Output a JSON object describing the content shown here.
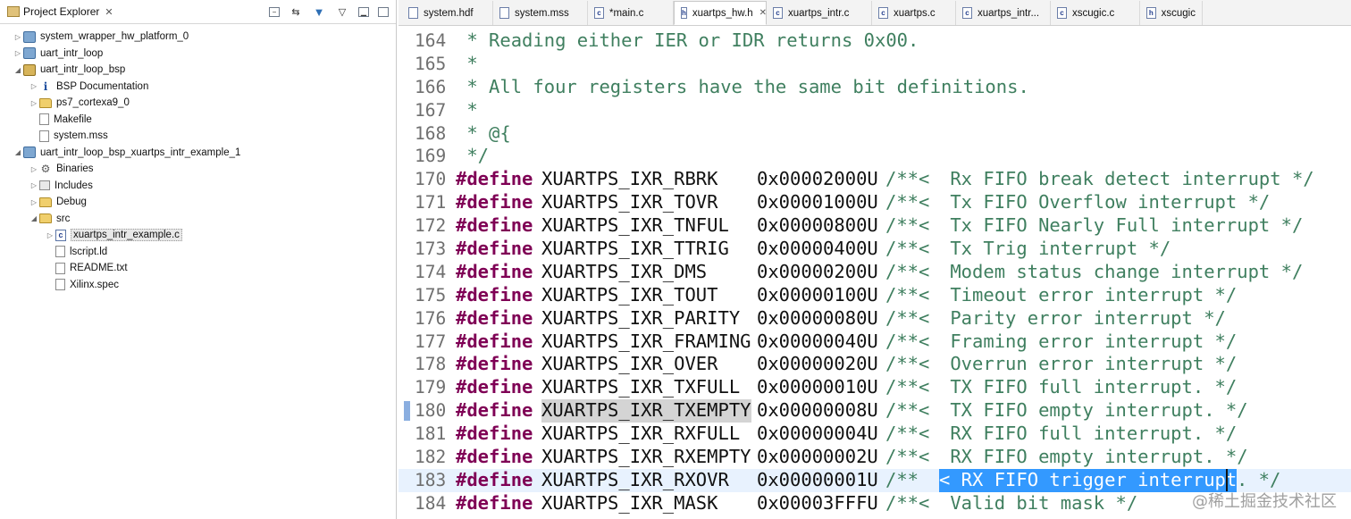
{
  "left_panel": {
    "title": "Project Explorer",
    "tree": [
      {
        "label": "system_wrapper_hw_platform_0",
        "arrow": "▷",
        "indent": 0,
        "icon": "proj"
      },
      {
        "label": "uart_intr_loop",
        "arrow": "▷",
        "indent": 0,
        "icon": "proj"
      },
      {
        "label": "uart_intr_loop_bsp",
        "arrow": "◢",
        "indent": 0,
        "icon": "bsp"
      },
      {
        "label": "BSP Documentation",
        "arrow": "▷",
        "indent": 1,
        "icon": "info"
      },
      {
        "label": "ps7_cortexa9_0",
        "arrow": "▷",
        "indent": 1,
        "icon": "folder"
      },
      {
        "label": "Makefile",
        "arrow": "",
        "indent": 1,
        "icon": "file"
      },
      {
        "label": "system.mss",
        "arrow": "",
        "indent": 1,
        "icon": "file"
      },
      {
        "label": "uart_intr_loop_bsp_xuartps_intr_example_1",
        "arrow": "◢",
        "indent": 0,
        "icon": "proj"
      },
      {
        "label": "Binaries",
        "arrow": "▷",
        "indent": 1,
        "icon": "bin"
      },
      {
        "label": "Includes",
        "arrow": "▷",
        "indent": 1,
        "icon": "inc"
      },
      {
        "label": "Debug",
        "arrow": "▷",
        "indent": 1,
        "icon": "folder"
      },
      {
        "label": "src",
        "arrow": "◢",
        "indent": 1,
        "icon": "folder"
      },
      {
        "label": "xuartps_intr_example.c",
        "arrow": "▷",
        "indent": 2,
        "icon": "cfile",
        "selected": true
      },
      {
        "label": "lscript.ld",
        "arrow": "",
        "indent": 2,
        "icon": "file"
      },
      {
        "label": "README.txt",
        "arrow": "",
        "indent": 2,
        "icon": "file"
      },
      {
        "label": "Xilinx.spec",
        "arrow": "",
        "indent": 2,
        "icon": "file"
      }
    ]
  },
  "editor": {
    "tabs": [
      {
        "label": "system.hdf",
        "icon": "",
        "active": false
      },
      {
        "label": "system.mss",
        "icon": "",
        "active": false
      },
      {
        "label": "*main.c",
        "icon": "c",
        "active": false
      },
      {
        "label": "xuartps_hw.h",
        "icon": "h",
        "active": true
      },
      {
        "label": "xuartps_intr.c",
        "icon": "c",
        "active": false
      },
      {
        "label": "xuartps.c",
        "icon": "c",
        "active": false
      },
      {
        "label": "xuartps_intr...",
        "icon": "c",
        "active": false
      },
      {
        "label": "xscugic.c",
        "icon": "c",
        "active": false
      },
      {
        "label": "xscugic",
        "icon": "h",
        "active": false
      }
    ],
    "comment_lines": [
      {
        "num": "164",
        "text": " * Reading either IER or IDR returns 0x00."
      },
      {
        "num": "165",
        "text": " *"
      },
      {
        "num": "166",
        "text": " * All four registers have the same bit definitions."
      },
      {
        "num": "167",
        "text": " *"
      },
      {
        "num": "168",
        "text": " * @{"
      },
      {
        "num": "169",
        "text": " */"
      }
    ],
    "define_lines": [
      {
        "num": "170",
        "kw": "#define",
        "name": "XUARTPS_IXR_RBRK",
        "value": "0x00002000U",
        "c1": "/**<",
        "comment": " Rx FIFO break detect interrupt */"
      },
      {
        "num": "171",
        "kw": "#define",
        "name": "XUARTPS_IXR_TOVR",
        "value": "0x00001000U",
        "c1": "/**<",
        "comment": " Tx FIFO Overflow interrupt */"
      },
      {
        "num": "172",
        "kw": "#define",
        "name": "XUARTPS_IXR_TNFUL",
        "value": "0x00000800U",
        "c1": "/**<",
        "comment": " Tx FIFO Nearly Full interrupt */"
      },
      {
        "num": "173",
        "kw": "#define",
        "name": "XUARTPS_IXR_TTRIG",
        "value": "0x00000400U",
        "c1": "/**<",
        "comment": " Tx Trig interrupt */"
      },
      {
        "num": "174",
        "kw": "#define",
        "name": "XUARTPS_IXR_DMS",
        "value": "0x00000200U",
        "c1": "/**<",
        "comment": " Modem status change interrupt */"
      },
      {
        "num": "175",
        "kw": "#define",
        "name": "XUARTPS_IXR_TOUT",
        "value": "0x00000100U",
        "c1": "/**<",
        "comment": " Timeout error interrupt */"
      },
      {
        "num": "176",
        "kw": "#define",
        "name": "XUARTPS_IXR_PARITY",
        "value": "0x00000080U",
        "c1": "/**<",
        "comment": " Parity error interrupt */"
      },
      {
        "num": "177",
        "kw": "#define",
        "name": "XUARTPS_IXR_FRAMING",
        "value": "0x00000040U",
        "c1": "/**<",
        "comment": " Framing error interrupt */"
      },
      {
        "num": "178",
        "kw": "#define",
        "name": "XUARTPS_IXR_OVER",
        "value": "0x00000020U",
        "c1": "/**<",
        "comment": " Overrun error interrupt */"
      },
      {
        "num": "179",
        "kw": "#define",
        "name": "XUARTPS_IXR_TXFULL",
        "value": "0x00000010U",
        "c1": "/**<",
        "comment": " TX FIFO full interrupt. */"
      },
      {
        "num": "180",
        "kw": "#define",
        "name": "XUARTPS_IXR_TXEMPTY",
        "value": "0x00000008U",
        "c1": "/**<",
        "comment": " TX FIFO empty interrupt. */"
      },
      {
        "num": "181",
        "kw": "#define",
        "name": "XUARTPS_IXR_RXFULL",
        "value": "0x00000004U",
        "c1": "/**<",
        "comment": " RX FIFO full interrupt. */"
      },
      {
        "num": "182",
        "kw": "#define",
        "name": "XUARTPS_IXR_RXEMPTY",
        "value": "0x00000002U",
        "c1": "/**<",
        "comment": " RX FIFO empty interrupt. */"
      },
      {
        "num": "183",
        "kw": "#define",
        "name": "XUARTPS_IXR_RXOVR",
        "value": "0x00000001U",
        "c1": "/**",
        "comment": "< RX FIFO trigger interrupt",
        "tail": ". */"
      },
      {
        "num": "184",
        "kw": "#define",
        "name": "XUARTPS_IXR_MASK",
        "value": "0x00003FFFU",
        "c1": "/**<",
        "comment": " Valid bit mask */"
      }
    ]
  },
  "watermark": "@稀土掘金技术社区"
}
